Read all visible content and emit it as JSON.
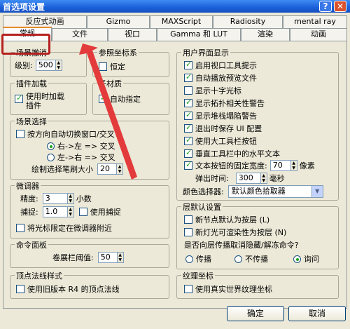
{
  "window": {
    "title": "首选项设置",
    "help_glyph": "?",
    "close_glyph": "✕"
  },
  "tabs_top": [
    "反应式动画",
    "Gizmo",
    "MAXScript",
    "Radiosity",
    "mental ray"
  ],
  "tabs_bottom": [
    "常规",
    "文件",
    "视口",
    "Gamma 和 LUT",
    "渲染",
    "动画"
  ],
  "active_tab": "常规",
  "scene_undo": {
    "title": "场景撤消",
    "level_label": "级别:",
    "level_value": "500"
  },
  "ref_coord": {
    "title": "参照坐标系",
    "constant_label": "恒定",
    "constant_checked": false
  },
  "plugin_load": {
    "title": "插件加载",
    "on_demand_label": "使用时加载插件",
    "on_demand_checked": true
  },
  "sub_material": {
    "title": "子材质",
    "auto_assign_label": "自动指定",
    "auto_assign_checked": true
  },
  "scene_select": {
    "title": "场景选择",
    "auto_switch_label": "按方向自动切换窗口/交叉",
    "auto_switch_checked": false,
    "option1": "右->左 => 交叉",
    "option2": "左->右 => 交叉",
    "selected_option": 1,
    "brush_label": "绘制选择笔刷大小",
    "brush_value": "20"
  },
  "spinners": {
    "title": "微调器",
    "precision_label": "精度:",
    "precision_value": "3",
    "precision_unit": "小数",
    "snap_label": "捕捉:",
    "snap_value": "1.0",
    "use_snap_label": "使用捕捉",
    "use_snap_checked": false,
    "wrap_cursor_label": "将光标限定在微调器附近",
    "wrap_cursor_checked": false
  },
  "command_panel": {
    "title": "命令面板",
    "rollup_label": "卷展栏阈值:",
    "rollup_value": "50"
  },
  "vertex_normal": {
    "title": "顶点法线样式",
    "legacy_label": "使用旧版本 R4 的顶点法线",
    "legacy_checked": false
  },
  "ui_display": {
    "title": "用户界面显示",
    "items": [
      {
        "label": "启用视口工具提示",
        "checked": true
      },
      {
        "label": "自动播放预览文件",
        "checked": true
      },
      {
        "label": "显示十字光标",
        "checked": false
      },
      {
        "label": "显示拓扑相关性警告",
        "checked": true
      },
      {
        "label": "显示堆栈塌陷警告",
        "checked": true
      },
      {
        "label": "退出时保存 UI 配置",
        "checked": true
      },
      {
        "label": "使用大工具栏按钮",
        "checked": true
      },
      {
        "label": "垂直工具栏中的水平文本",
        "checked": true
      },
      {
        "label": "文本按钮的固定宽度:",
        "checked": true
      }
    ],
    "fixed_width_value": "70",
    "fixed_width_unit": "像素",
    "flyout_label": "弹出时间:",
    "flyout_value": "300",
    "flyout_unit": "毫秒",
    "color_picker_label": "颜色选择器:",
    "color_picker_value": "默认颜色拾取器"
  },
  "layer_defaults": {
    "title": "层默认设置",
    "nodes_by_layer_label": "新节点默认为按层 (L)",
    "nodes_by_layer_checked": false,
    "lights_by_layer_label": "新灯光可渲染性为按层 (N)",
    "lights_by_layer_checked": false,
    "question": "是否向层传播取消隐藏/解冻命令?",
    "radio_propagate": "传播",
    "radio_no_propagate": "不传播",
    "radio_ask": "询问",
    "selected_radio": "询问"
  },
  "texture_coords": {
    "title": "纹理坐标",
    "real_world_label": "使用真实世界纹理坐标",
    "real_world_checked": false
  },
  "buttons": {
    "ok": "确定",
    "cancel": "取消"
  }
}
